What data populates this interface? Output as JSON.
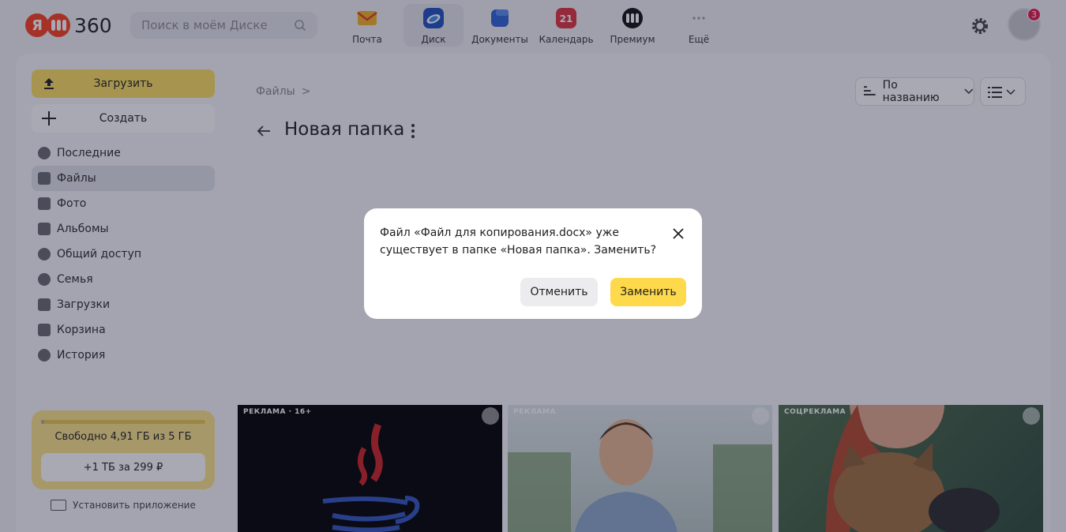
{
  "header": {
    "logo_letter": "Я",
    "logo_text": "360",
    "search_placeholder": "Поиск в моём Диске",
    "services": [
      {
        "label": "Почта",
        "icon": "mail-icon",
        "color": "#f5a623"
      },
      {
        "label": "Диск",
        "icon": "disk-icon",
        "color": "#1f6fe0",
        "active": true
      },
      {
        "label": "Документы",
        "icon": "documents-icon",
        "color": "#3a6fe0"
      },
      {
        "label": "Календарь",
        "icon": "calendar-icon",
        "color": "#e63946",
        "day": "21"
      },
      {
        "label": "Премиум",
        "icon": "premium-icon",
        "color": "#111111"
      },
      {
        "label": "Ещё",
        "icon": "more-icon",
        "color": "#888888"
      }
    ],
    "notifications_count": "3"
  },
  "sidebar": {
    "upload_label": "Загрузить",
    "create_label": "Создать",
    "items": [
      {
        "label": "Последние",
        "icon": "clock-icon"
      },
      {
        "label": "Файлы",
        "icon": "file-icon",
        "active": true
      },
      {
        "label": "Фото",
        "icon": "photo-icon"
      },
      {
        "label": "Альбомы",
        "icon": "albums-icon"
      },
      {
        "label": "Общий доступ",
        "icon": "shared-icon"
      },
      {
        "label": "Семья",
        "icon": "family-icon"
      },
      {
        "label": "Загрузки",
        "icon": "download-icon"
      },
      {
        "label": "Корзина",
        "icon": "trash-icon"
      },
      {
        "label": "История",
        "icon": "history-icon"
      }
    ],
    "quota_text": "Свободно 4,91 ГБ из 5 ГБ",
    "quota_used_fraction": 0.02,
    "quota_button": "+1 ТБ за 299 ₽",
    "install_label": "Установить приложение"
  },
  "main": {
    "breadcrumb": "Файлы",
    "breadcrumb_sep": ">",
    "title": "Новая папка",
    "sort_label": "По названию"
  },
  "ads": [
    {
      "label": "РЕКЛАМА · 16+"
    },
    {
      "label": "РЕКЛАМА"
    },
    {
      "label": "СОЦРЕКЛАМА"
    }
  ],
  "dialog": {
    "message": "Файл «Файл для копирования.docx» уже существует в папке «Новая папка». Заменить?",
    "cancel_label": "Отменить",
    "confirm_label": "Заменить"
  },
  "colors": {
    "accent_yellow": "#fddf5e",
    "brand_red": "#fc3f1d"
  }
}
